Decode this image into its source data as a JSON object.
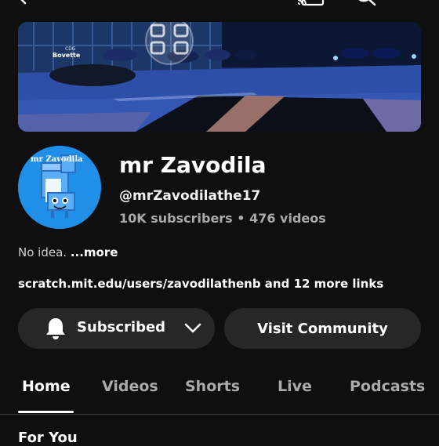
{
  "banner": {
    "watermark_label": "Bovette",
    "logo_text": "CDG"
  },
  "avatar": {
    "text": "mr Zavodila"
  },
  "channel": {
    "name": "mr Zavodila",
    "handle": "@mrZavodilathe17",
    "subscribers": "10K subscribers",
    "separator": " • ",
    "videos": "476 videos"
  },
  "description": {
    "text": "No idea. ",
    "more": "...more"
  },
  "links": {
    "text": "scratch.mit.edu/users/zavodilathenb and 12 more links"
  },
  "buttons": {
    "subscribed": "Subscribed",
    "visit_community": "Visit Community"
  },
  "tabs": [
    {
      "label": "Home",
      "active": true
    },
    {
      "label": "Videos"
    },
    {
      "label": "Shorts"
    },
    {
      "label": "Live"
    },
    {
      "label": "Podcasts"
    }
  ],
  "section": {
    "title": "For You"
  },
  "icons": {
    "back": "back-arrow-icon",
    "cast": "cast-icon",
    "search": "search-icon",
    "more": "more-vert-icon",
    "bell": "bell-icon",
    "chevron": "chevron-down-icon"
  }
}
